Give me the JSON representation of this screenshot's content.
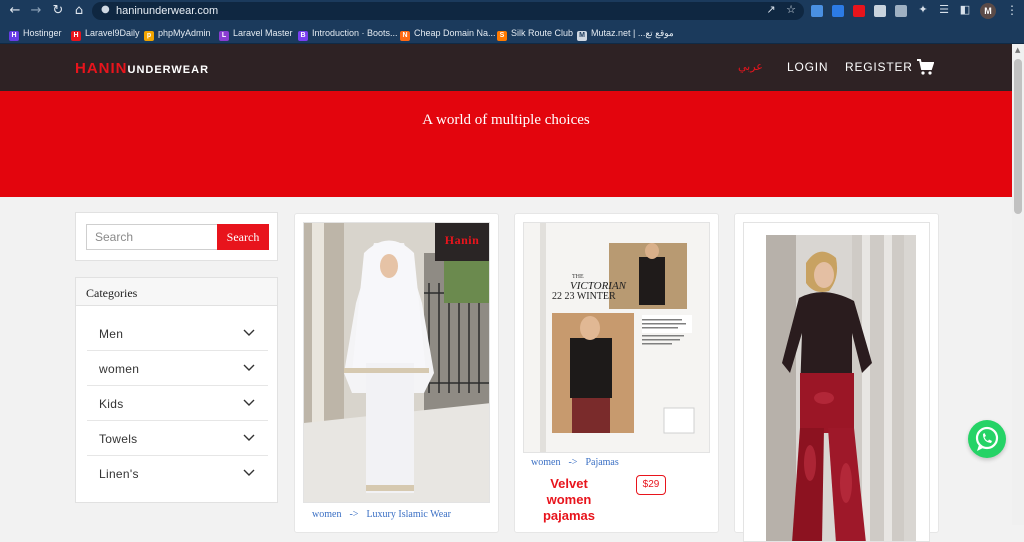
{
  "browser": {
    "url": "haninunderwear.com",
    "avatar_letter": "M",
    "bookmarks": [
      {
        "label": "Hostinger",
        "color": "#673de6",
        "glyph": "H"
      },
      {
        "label": "Laravel9Daily",
        "color": "#e8141c",
        "glyph": "H"
      },
      {
        "label": "phpMyAdmin",
        "color": "#f0a400",
        "glyph": "p"
      },
      {
        "label": "Laravel Master",
        "color": "#8a3dd1",
        "glyph": "L"
      },
      {
        "label": "Introduction · Boots...",
        "color": "#7a3ff2",
        "glyph": "B"
      },
      {
        "label": "Cheap Domain Na...",
        "color": "#ff6a14",
        "glyph": "N"
      },
      {
        "label": "Silk Route Club",
        "color": "#ff7a00",
        "glyph": "S"
      },
      {
        "label": "Mutaz.net | ...موقع تع",
        "color": "#cfd8e2",
        "glyph": "M"
      }
    ]
  },
  "site": {
    "logo_red": "HANIN",
    "logo_white": "UNDERWEAR",
    "nav": {
      "arabic": "عربي",
      "login": "LOGIN",
      "register": "REGISTER"
    },
    "hero_text": "A world of multiple choices"
  },
  "search": {
    "placeholder": "Search",
    "button": "Search"
  },
  "categories": {
    "title": "Categories",
    "items": [
      "Men",
      "women",
      "Kids",
      "Towels",
      "Linen's"
    ]
  },
  "products": [
    {
      "category": "women",
      "subcategory": "Luxury Islamic Wear",
      "badge": "Hanin"
    },
    {
      "category": "women",
      "subcategory": "Pajamas",
      "name_lines": [
        "Velvet",
        "women",
        "pajamas"
      ],
      "price": "$29",
      "magazine": {
        "title_small": "THE",
        "title": "VICTORIAN",
        "season": "22 23 WINTER"
      }
    },
    {
      "category": "",
      "subcategory": ""
    }
  ],
  "colors": {
    "brand_red": "#e8141c",
    "nav_dark": "#2e2224",
    "hero_red": "#e3050d",
    "whatsapp": "#25d366"
  }
}
